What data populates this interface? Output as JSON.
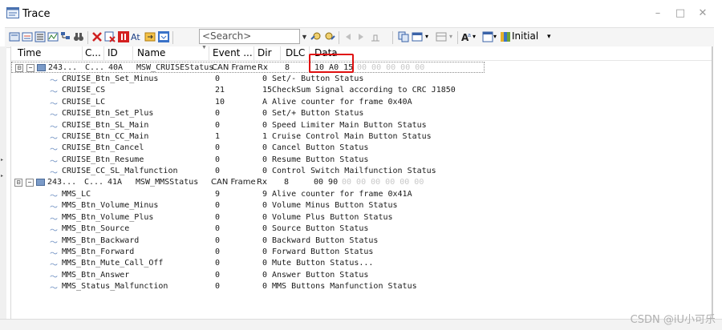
{
  "window": {
    "title": "Trace",
    "min": "–",
    "max": "□",
    "close": "✕"
  },
  "toolbar": {
    "search_placeholder": "<Search>",
    "view_label": "Initial"
  },
  "columns": [
    "Time",
    "C...",
    "ID",
    "Name",
    "Event ...",
    "Dir",
    "DLC",
    "Data"
  ],
  "messages": [
    {
      "time": "243...",
      "chn": "C...",
      "id": "40A",
      "name": "MSW_CRUISEStatus",
      "event": "CAN Frame",
      "dir": "Rx",
      "dlc": "8",
      "data_hl": "10 A0 15",
      "data_rest": "00 00 00 00 00",
      "signals": [
        {
          "name": "CRUISE_Btn_Set_Minus",
          "phys": "0",
          "raw": "0",
          "comment": "Set/- Button Status"
        },
        {
          "name": "CRUISE_CS",
          "phys": "21",
          "raw": "15",
          "comment": "CheckSum Signal according to CRC J1850"
        },
        {
          "name": "CRUISE_LC",
          "phys": "10",
          "raw": "A",
          "comment": "Alive counter for frame 0x40A"
        },
        {
          "name": "CRUISE_Btn_Set_Plus",
          "phys": "0",
          "raw": "0",
          "comment": "Set/+ Button Status"
        },
        {
          "name": "CRUISE_Btn_SL_Main",
          "phys": "0",
          "raw": "0",
          "comment": "Speed Limiter Main Button Status"
        },
        {
          "name": "CRUISE_Btn_CC_Main",
          "phys": "1",
          "raw": "1",
          "comment": "Cruise Control Main Button Status"
        },
        {
          "name": "CRUISE_Btn_Cancel",
          "phys": "0",
          "raw": "0",
          "comment": "Cancel Button Status"
        },
        {
          "name": "CRUISE_Btn_Resume",
          "phys": "0",
          "raw": "0",
          "comment": "Resume Button Status"
        },
        {
          "name": "CRUISE_CC_SL_Malfunction",
          "phys": "0",
          "raw": "0",
          "comment": "Control Switch Mailfunction Status"
        }
      ]
    },
    {
      "time": "243...",
      "chn": "C...",
      "id": "41A",
      "name": "MSW_MMSStatus",
      "event": "CAN Frame",
      "dir": "Rx",
      "dlc": "8",
      "data_hl": "00 90",
      "data_rest": "00 00 00 00 00 00",
      "signals": [
        {
          "name": "MMS_LC",
          "phys": "9",
          "raw": "9",
          "comment": "Alive counter for frame 0x41A"
        },
        {
          "name": "MMS_Btn_Volume_Minus",
          "phys": "0",
          "raw": "0",
          "comment": "Volume Minus Button Status"
        },
        {
          "name": "MMS_Btn_Volume_Plus",
          "phys": "0",
          "raw": "0",
          "comment": "Volume Plus Button Status"
        },
        {
          "name": "MMS_Btn_Source",
          "phys": "0",
          "raw": "0",
          "comment": "Source Button Status"
        },
        {
          "name": "MMS_Btn_Backward",
          "phys": "0",
          "raw": "0",
          "comment": "Backward Button Status"
        },
        {
          "name": "MMS_Btn_Forward",
          "phys": "0",
          "raw": "0",
          "comment": "Forward Button Status"
        },
        {
          "name": "MMS_Btn_Mute_Call_Off",
          "phys": "0",
          "raw": "0",
          "comment": "Mute Button Status..."
        },
        {
          "name": "MMS_Btn_Answer",
          "phys": "0",
          "raw": "0",
          "comment": "Answer Button Status"
        },
        {
          "name": "MMS_Status_Malfunction",
          "phys": "0",
          "raw": "0",
          "comment": "MMS Buttons Manfunction Status"
        }
      ]
    }
  ],
  "watermark": "CSDN @iU小可乐"
}
